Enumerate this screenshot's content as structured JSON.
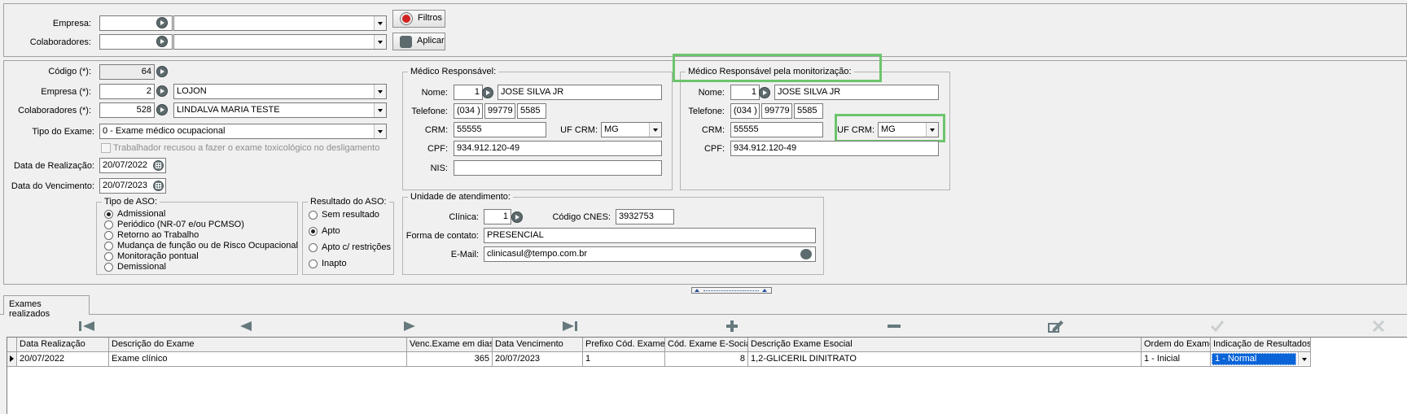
{
  "filter": {
    "empresa_label": "Empresa:",
    "colaboradores_label": "Colaboradores:",
    "filtros_label": "Filtros",
    "aplicar_label": "Aplicar"
  },
  "form": {
    "codigo_label": "Código (*):",
    "codigo_value": "64",
    "empresa_label": "Empresa (*):",
    "empresa_id": "2",
    "empresa_name": "LOJON",
    "colab_label": "Colaboradores (*):",
    "colab_id": "528",
    "colab_name": "LINDALVA MARIA TESTE",
    "tipo_exame_label": "Tipo do Exame:",
    "tipo_exame_value": "0 - Exame médico ocupacional",
    "recusou_label": "Trabalhador recusou a fazer o exame toxicológico no desligamento",
    "data_realizacao_label": "Data de Realização:",
    "data_realizacao_value": "20/07/2022",
    "data_vencimento_label": "Data do Vencimento:",
    "data_vencimento_value": "20/07/2023"
  },
  "tipo_aso": {
    "legend": "Tipo de ASO:",
    "options": [
      "Admissional",
      "Periódico (NR-07 e/ou PCMSO)",
      "Retorno ao Trabalho",
      "Mudança de função ou de Risco Ocupacional",
      "Monitoração pontual",
      "Demissional"
    ]
  },
  "resultado_aso": {
    "legend": "Resultado do ASO:",
    "options": [
      "Sem resultado",
      "Apto",
      "Apto c/ restrições",
      "Inapto"
    ]
  },
  "medico": {
    "legend": "Médico Responsável:",
    "nome_label": "Nome:",
    "nome_id": "1",
    "nome_value": "JOSE SILVA JR",
    "tel_label": "Telefone:",
    "tel_ddd": "(034 )",
    "tel_p1": "99779",
    "tel_p2": "5585",
    "crm_label": "CRM:",
    "crm_value": "55555",
    "uf_label": "UF CRM:",
    "uf_value": "MG",
    "cpf_label": "CPF:",
    "cpf_value": "934.912.120-49",
    "nis_label": "NIS:"
  },
  "medico_mon": {
    "legend": "Médico Responsável pela monitorização:",
    "nome_label": "Nome:",
    "nome_id": "1",
    "nome_value": "JOSE SILVA JR",
    "tel_label": "Telefone:",
    "tel_ddd": "(034 )",
    "tel_p1": "99779",
    "tel_p2": "5585",
    "crm_label": "CRM:",
    "crm_value": "55555",
    "uf_label": "UF CRM:",
    "uf_value": "MG",
    "cpf_label": "CPF:",
    "cpf_value": "934.912.120-49"
  },
  "unidade": {
    "legend": "Unidade de atendimento:",
    "clinica_label": "Clínica:",
    "clinica_id": "1",
    "cnes_label": "Código CNES:",
    "cnes_value": "3932753",
    "contato_label": "Forma de contato:",
    "contato_value": "PRESENCIAL",
    "email_label": "E-Mail:",
    "email_value": "clinicasul@tempo.com.br"
  },
  "tab": {
    "label": "Exames realizados"
  },
  "grid": {
    "headers": [
      "Data Realização",
      "Descrição do Exame",
      "Venc.Exame em dias",
      "Data Vencimento",
      "Prefixo Cód. Exame",
      "Cód. Exame E-Social",
      "Descrição Exame Esocial",
      "Ordem do Exame",
      "Indicação de Resultados"
    ],
    "row": [
      "20/07/2022",
      "Exame clínico",
      "365",
      "20/07/2023",
      "1",
      "8",
      "1,2-GLICERIL DINITRATO",
      "1 - Inicial",
      "1 - Normal"
    ]
  },
  "colors": {
    "highlight": "#6cc56c",
    "selection": "#0a64d8"
  }
}
